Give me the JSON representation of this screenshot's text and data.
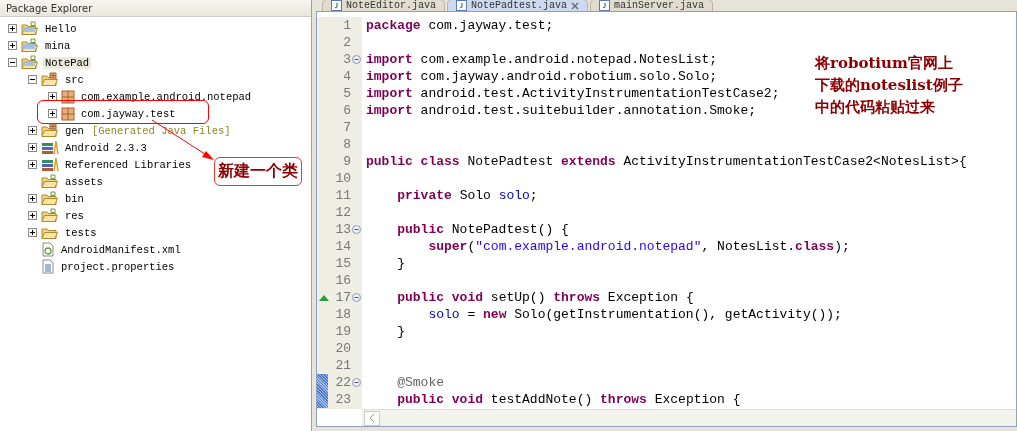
{
  "package_explorer": {
    "title": "Package Explorer",
    "tree": [
      {
        "label": "Hello",
        "kind": "project",
        "expanded": false
      },
      {
        "label": "mina",
        "kind": "project",
        "expanded": false
      },
      {
        "label": "NotePad",
        "kind": "project",
        "expanded": true,
        "selected": true,
        "children": [
          {
            "label": "src",
            "kind": "source-folder",
            "expanded": true,
            "children": [
              {
                "label": "com.example.android.notepad",
                "kind": "package",
                "expanded": false
              },
              {
                "label": "com.jayway.test",
                "kind": "package",
                "expanded": false,
                "highlighted": true
              }
            ]
          },
          {
            "label": "gen",
            "decoration": "[Generated Java Files]",
            "kind": "source-folder",
            "expanded": false
          },
          {
            "label": "Android 2.3.3",
            "kind": "library",
            "expanded": false
          },
          {
            "label": "Referenced Libraries",
            "kind": "library",
            "expanded": false
          },
          {
            "label": "assets",
            "kind": "folder"
          },
          {
            "label": "bin",
            "kind": "folder",
            "expanded": false
          },
          {
            "label": "res",
            "kind": "folder",
            "expanded": false
          },
          {
            "label": "tests",
            "kind": "plain-folder",
            "expanded": false
          },
          {
            "label": "AndroidManifest.xml",
            "kind": "xml-file"
          },
          {
            "label": "project.properties",
            "kind": "text-file"
          }
        ]
      }
    ]
  },
  "editor": {
    "tabs": [
      {
        "label": "NoteEditor.java",
        "selected": false
      },
      {
        "label": "NotePadtest.java",
        "selected": true
      },
      {
        "label": "mainServer.java",
        "selected": false
      }
    ],
    "lines": [
      {
        "number": "1",
        "fold": false,
        "override": false,
        "changed": false,
        "tokens": [
          {
            "kind": "kw",
            "text": "package"
          },
          {
            "kind": "plain",
            "text": " com.jayway.test;"
          }
        ]
      },
      {
        "number": "2",
        "fold": false,
        "override": false,
        "changed": false
      },
      {
        "number": "3",
        "fold": true,
        "override": false,
        "changed": false,
        "tokens": [
          {
            "kind": "kw",
            "text": "import"
          },
          {
            "kind": "plain",
            "text": " com.example.android.notepad.NotesList;"
          }
        ]
      },
      {
        "number": "4",
        "fold": false,
        "override": false,
        "changed": false,
        "tokens": [
          {
            "kind": "kw",
            "text": "import"
          },
          {
            "kind": "plain",
            "text": " com.jayway.android.robotium.solo.Solo;"
          }
        ]
      },
      {
        "number": "5",
        "fold": false,
        "override": false,
        "changed": false,
        "tokens": [
          {
            "kind": "kw",
            "text": "import"
          },
          {
            "kind": "plain",
            "text": " android.test.ActivityInstrumentationTestCase2;"
          }
        ]
      },
      {
        "number": "6",
        "fold": false,
        "override": false,
        "changed": false,
        "tokens": [
          {
            "kind": "kw",
            "text": "import"
          },
          {
            "kind": "plain",
            "text": " android.test.suitebuilder.annotation.Smoke;"
          }
        ]
      },
      {
        "number": "7",
        "fold": false,
        "override": false,
        "changed": false
      },
      {
        "number": "8",
        "fold": false,
        "override": false,
        "changed": false
      },
      {
        "number": "9",
        "fold": false,
        "override": false,
        "changed": false,
        "tokens": [
          {
            "kind": "kw",
            "text": "public class"
          },
          {
            "kind": "plain",
            "text": " NotePadtest "
          },
          {
            "kind": "kw",
            "text": "extends"
          },
          {
            "kind": "plain",
            "text": " ActivityInstrumentationTestCase2<NotesList>{"
          }
        ]
      },
      {
        "number": "10",
        "fold": false,
        "override": false,
        "changed": false
      },
      {
        "number": "11",
        "fold": false,
        "override": false,
        "changed": false,
        "tokens": [
          {
            "kind": "kw",
            "text": "    private"
          },
          {
            "kind": "plain",
            "text": " Solo "
          },
          {
            "kind": "field",
            "text": "solo"
          },
          {
            "kind": "plain",
            "text": ";"
          }
        ]
      },
      {
        "number": "12",
        "fold": false,
        "override": false,
        "changed": false
      },
      {
        "number": "13",
        "fold": true,
        "override": false,
        "changed": false,
        "tokens": [
          {
            "kind": "kw",
            "text": "    public"
          },
          {
            "kind": "plain",
            "text": " NotePadtest() {"
          }
        ]
      },
      {
        "number": "14",
        "fold": false,
        "override": false,
        "changed": false,
        "tokens": [
          {
            "kind": "kw",
            "text": "        super"
          },
          {
            "kind": "plain",
            "text": "("
          },
          {
            "kind": "string",
            "text": "\"com.example.android.notepad\""
          },
          {
            "kind": "plain",
            "text": ", NotesList."
          },
          {
            "kind": "kw",
            "text": "class"
          },
          {
            "kind": "plain",
            "text": ");"
          }
        ]
      },
      {
        "number": "15",
        "fold": false,
        "override": false,
        "changed": false,
        "tokens": [
          {
            "kind": "plain",
            "text": "    }"
          }
        ]
      },
      {
        "number": "16",
        "fold": false,
        "override": false,
        "changed": false
      },
      {
        "number": "17",
        "fold": true,
        "override": true,
        "changed": false,
        "tokens": [
          {
            "kind": "kw",
            "text": "    public void"
          },
          {
            "kind": "plain",
            "text": " setUp() "
          },
          {
            "kind": "kw",
            "text": "throws"
          },
          {
            "kind": "plain",
            "text": " Exception {"
          }
        ]
      },
      {
        "number": "18",
        "fold": false,
        "override": false,
        "changed": false,
        "tokens": [
          {
            "kind": "field",
            "text": "        solo"
          },
          {
            "kind": "plain",
            "text": " = "
          },
          {
            "kind": "kw",
            "text": "new"
          },
          {
            "kind": "plain",
            "text": " Solo(getInstrumentation(), getActivity());"
          }
        ]
      },
      {
        "number": "19",
        "fold": false,
        "override": false,
        "changed": false,
        "tokens": [
          {
            "kind": "plain",
            "text": "    }"
          }
        ]
      },
      {
        "number": "20",
        "fold": false,
        "override": false,
        "changed": false
      },
      {
        "number": "21",
        "fold": false,
        "override": false,
        "changed": false
      },
      {
        "number": "22",
        "fold": true,
        "override": false,
        "changed": true,
        "tokens": [
          {
            "kind": "annotation",
            "text": "    @Smoke"
          }
        ]
      },
      {
        "number": "23",
        "fold": false,
        "override": false,
        "changed": true,
        "tokens": [
          {
            "kind": "kw",
            "text": "    public void"
          },
          {
            "kind": "plain",
            "text": " testAddNote() "
          },
          {
            "kind": "kw",
            "text": "throws"
          },
          {
            "kind": "plain",
            "text": " Exception {"
          }
        ]
      }
    ]
  },
  "annotations": [
    {
      "kind": "callout",
      "text": "新建一个类"
    },
    {
      "kind": "note",
      "text": "将robotium官网上下载的noteslist例子中的代码粘贴过来"
    }
  ]
}
